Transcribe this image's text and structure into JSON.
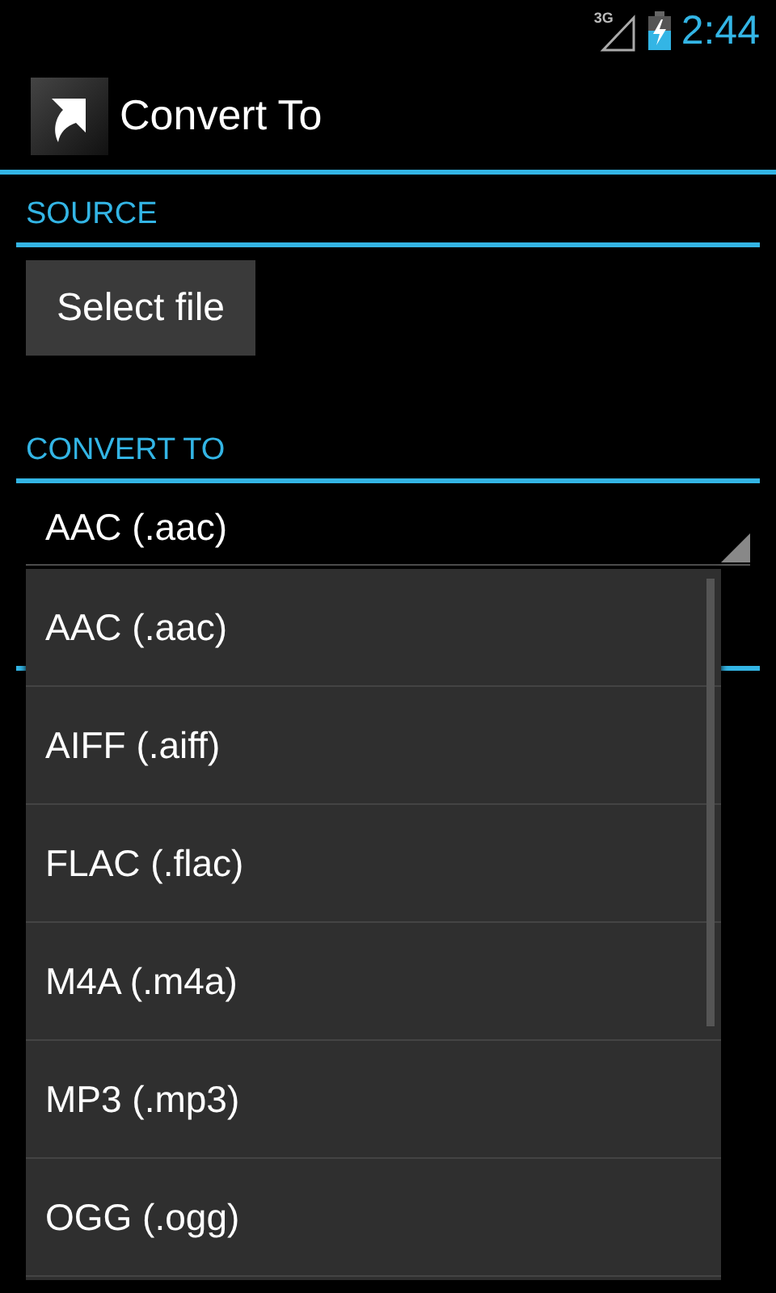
{
  "status_bar": {
    "network": "3G",
    "time": "2:44"
  },
  "action_bar": {
    "title": "Convert To"
  },
  "source": {
    "header": "SOURCE",
    "button": "Select file"
  },
  "convert_to": {
    "header": "CONVERT TO",
    "spinner_value": "AAC (.aac)"
  },
  "dropdown": {
    "options": [
      {
        "label": "AAC (.aac)"
      },
      {
        "label": "AIFF (.aiff)"
      },
      {
        "label": "FLAC (.flac)"
      },
      {
        "label": "M4A (.m4a)"
      },
      {
        "label": "MP3 (.mp3)"
      },
      {
        "label": "OGG (.ogg)"
      }
    ]
  }
}
